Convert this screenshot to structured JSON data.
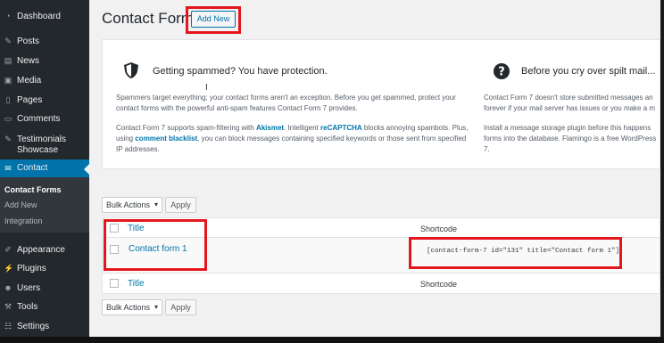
{
  "sidebar": {
    "items": [
      {
        "label": "Dashboard",
        "icon": "dashboard-icon"
      },
      {
        "label": "Posts",
        "icon": "pin-icon"
      },
      {
        "label": "News",
        "icon": "news-icon"
      },
      {
        "label": "Media",
        "icon": "media-icon"
      },
      {
        "label": "Pages",
        "icon": "page-icon"
      },
      {
        "label": "Comments",
        "icon": "comment-icon"
      },
      {
        "label": "Testimonials",
        "label2": "Showcase",
        "icon": "pin-icon"
      },
      {
        "label": "Contact",
        "icon": "mail-icon"
      },
      {
        "label": "Appearance",
        "icon": "brush-icon"
      },
      {
        "label": "Plugins",
        "icon": "plug-icon"
      },
      {
        "label": "Users",
        "icon": "user-icon"
      },
      {
        "label": "Tools",
        "icon": "wrench-icon"
      },
      {
        "label": "Settings",
        "icon": "settings-icon"
      }
    ],
    "submenu": [
      "Contact Forms",
      "Add New",
      "Integration"
    ]
  },
  "header": {
    "title": "Contact Forms",
    "add_new": "Add New"
  },
  "panel": {
    "left": {
      "heading": "Getting spammed? You have protection.",
      "p1": "Spammers target everything; your contact forms aren't an exception. Before you get spammed, protect your contact forms with the powerful anti-spam features Contact Form 7 provides.",
      "p2_a": "Contact Form 7 supports spam-filtering with ",
      "p2_akismet": "Akismet",
      "p2_b": ". Intelligent ",
      "p2_recaptcha": "reCAPTCHA",
      "p2_c": " blocks annoying spambots. Plus, using ",
      "p2_blacklist": "comment blacklist",
      "p2_d": ", you can block messages containing specified keywords or those sent from specified IP addresses."
    },
    "right": {
      "heading": "Before you cry over spilt mail...",
      "p1": "Contact Form 7 doesn't store submitted messages an forever if your mail server has issues or you make a m",
      "p2": "Install a message storage plugin before this happens forms into the database. Flamingo is a free WordPress 7."
    }
  },
  "bulk": {
    "label": "Bulk Actions",
    "apply": "Apply"
  },
  "table": {
    "col_title": "Title",
    "col_shortcode": "Shortcode",
    "rows": [
      {
        "title": "Contact form 1",
        "shortcode": "[contact-form-7 id=\"131\" title=\"Contact form 1\"]"
      }
    ]
  },
  "colors": {
    "sidebar_bg": "#23282d",
    "accent": "#0073aa",
    "highlight_border": "#e3161e"
  }
}
